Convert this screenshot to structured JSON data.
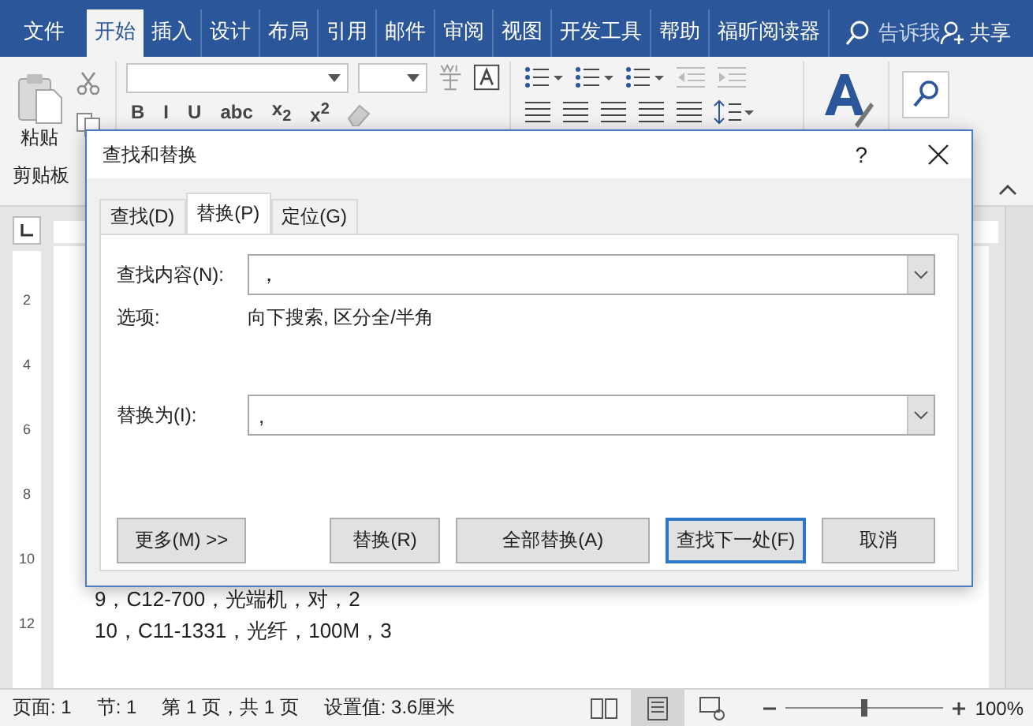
{
  "menu_tabs": [
    {
      "label": "文件",
      "selected": false
    },
    {
      "label": "开始",
      "selected": true
    },
    {
      "label": "插入",
      "selected": false
    },
    {
      "label": "设计",
      "selected": false
    },
    {
      "label": "布局",
      "selected": false
    },
    {
      "label": "引用",
      "selected": false
    },
    {
      "label": "邮件",
      "selected": false
    },
    {
      "label": "审阅",
      "selected": false
    },
    {
      "label": "视图",
      "selected": false
    },
    {
      "label": "开发工具",
      "selected": false
    },
    {
      "label": "帮助",
      "selected": false
    },
    {
      "label": "福昕阅读器",
      "selected": false
    }
  ],
  "tell_me": "告诉我",
  "share": "共享",
  "ribbon": {
    "paste": "粘贴",
    "clipboard": "剪贴板",
    "format_buttons": [
      "B",
      "I",
      "U",
      "abc",
      "x$_{2}$",
      "x$^{2}$"
    ]
  },
  "ruler_numbers": [
    "2",
    "4",
    "6",
    "8",
    "10",
    "12"
  ],
  "document_lines": [
    "9，C12-700，光端机，对，2",
    "10，C11-1331，光纤，100M，3"
  ],
  "dialog": {
    "title": "查找和替换",
    "help": "?",
    "tabs": [
      {
        "label": "查找(D)",
        "selected": false
      },
      {
        "label": "替换(P)",
        "selected": true
      },
      {
        "label": "定位(G)",
        "selected": false
      }
    ],
    "find": {
      "label": "查找内容(N):",
      "value": "，"
    },
    "options": {
      "label": "选项:",
      "value": "向下搜索, 区分全/半角"
    },
    "replace": {
      "label": "替换为(I):",
      "value": ","
    },
    "buttons": [
      {
        "label": "更多(M) >>",
        "default": false
      },
      {
        "label": "替换(R)",
        "default": false
      },
      {
        "label": "全部替换(A)",
        "default": false
      },
      {
        "label": "查找下一处(F)",
        "default": true
      },
      {
        "label": "取消",
        "default": false
      }
    ]
  },
  "status_bar": {
    "items": [
      "页面: 1",
      "节: 1",
      "第 1 页，共 1 页",
      "设置值: 3.6厘米"
    ],
    "views": [
      {
        "selected": false
      },
      {
        "selected": true
      },
      {
        "selected": false
      }
    ],
    "zoom_slider": {
      "level": 0.5
    },
    "zoom": "100%"
  }
}
